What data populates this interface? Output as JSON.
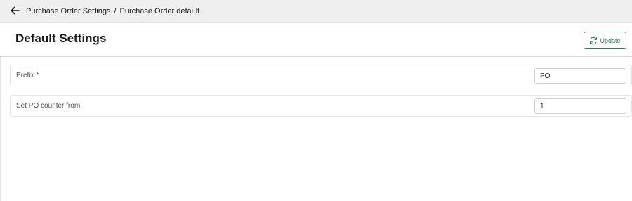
{
  "breadcrumb": {
    "parent": "Purchase Order Settings",
    "separator": "/",
    "current": "Purchase Order default"
  },
  "header": {
    "title": "Default Settings",
    "update_label": "Update"
  },
  "form": {
    "prefix": {
      "label": "Prefix *",
      "value": "PO"
    },
    "counter": {
      "label": "Set PO counter from",
      "value": "1"
    }
  },
  "colors": {
    "accent": "#2e7d62",
    "topbar_bg": "#efefef"
  },
  "icons": {
    "back": "arrow-left-icon",
    "update": "refresh-icon"
  }
}
